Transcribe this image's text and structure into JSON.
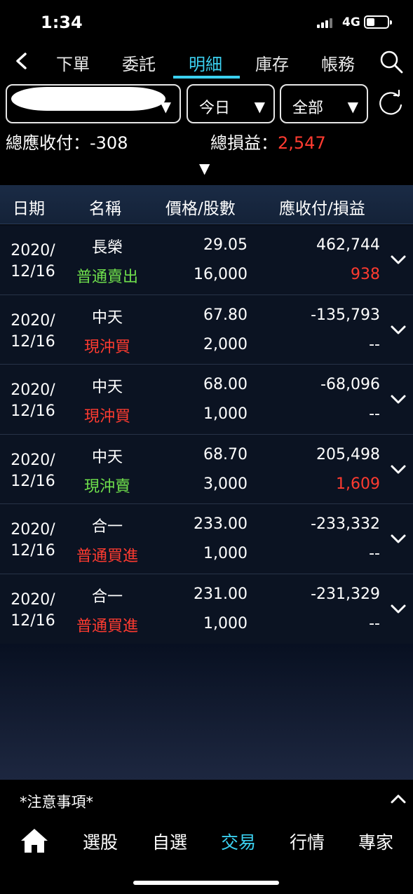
{
  "status": {
    "time": "1:34",
    "network": "4G"
  },
  "nav": {
    "tabs": [
      {
        "label": "下單"
      },
      {
        "label": "委託"
      },
      {
        "label": "明細"
      },
      {
        "label": "庫存"
      },
      {
        "label": "帳務"
      }
    ],
    "active_tab": "明細",
    "icons": {
      "back": "chevron-left-icon",
      "search": "search-icon"
    }
  },
  "filters": {
    "account": {
      "value": ""
    },
    "date": {
      "value": "今日"
    },
    "category": {
      "value": "全部"
    },
    "caret": "▼"
  },
  "summary": {
    "total_label": "總應收付：",
    "total_value": "-308",
    "pnl_label": "總損益：",
    "pnl_value": "2,547",
    "expand": "▼"
  },
  "table": {
    "headers": [
      "日期",
      "名稱",
      "價格/股數",
      "應收付/損益"
    ],
    "rows": [
      {
        "date1": "2020/",
        "date2": "12/16",
        "stock": "長榮",
        "type": "普通賣出",
        "type_color": "green",
        "price": "29.05",
        "qty": "16,000",
        "amount": "462,744",
        "pnl": "938",
        "pnl_color": "red"
      },
      {
        "date1": "2020/",
        "date2": "12/16",
        "stock": "中天",
        "type": "現沖買",
        "type_color": "red",
        "price": "67.80",
        "qty": "2,000",
        "amount": "-135,793",
        "pnl": "--",
        "pnl_color": "white"
      },
      {
        "date1": "2020/",
        "date2": "12/16",
        "stock": "中天",
        "type": "現沖買",
        "type_color": "red",
        "price": "68.00",
        "qty": "1,000",
        "amount": "-68,096",
        "pnl": "--",
        "pnl_color": "white"
      },
      {
        "date1": "2020/",
        "date2": "12/16",
        "stock": "中天",
        "type": "現沖賣",
        "type_color": "green",
        "price": "68.70",
        "qty": "3,000",
        "amount": "205,498",
        "pnl": "1,609",
        "pnl_color": "red"
      },
      {
        "date1": "2020/",
        "date2": "12/16",
        "stock": "合一",
        "type": "普通買進",
        "type_color": "red",
        "price": "233.00",
        "qty": "1,000",
        "amount": "-233,332",
        "pnl": "--",
        "pnl_color": "white"
      },
      {
        "date1": "2020/",
        "date2": "12/16",
        "stock": "合一",
        "type": "普通買進",
        "type_color": "red",
        "price": "231.00",
        "qty": "1,000",
        "amount": "-231,329",
        "pnl": "--",
        "pnl_color": "white"
      }
    ]
  },
  "notice": {
    "label": "*注意事項*"
  },
  "bottom_nav": {
    "items": [
      {
        "label": "選股"
      },
      {
        "label": "自選"
      },
      {
        "label": "交易"
      },
      {
        "label": "行情"
      },
      {
        "label": "專家"
      }
    ],
    "active": "交易",
    "home_icon": "home-icon"
  },
  "colors": {
    "accent": "#3bd0f0",
    "up": "#ff3b30",
    "down": "#6fe04c"
  }
}
